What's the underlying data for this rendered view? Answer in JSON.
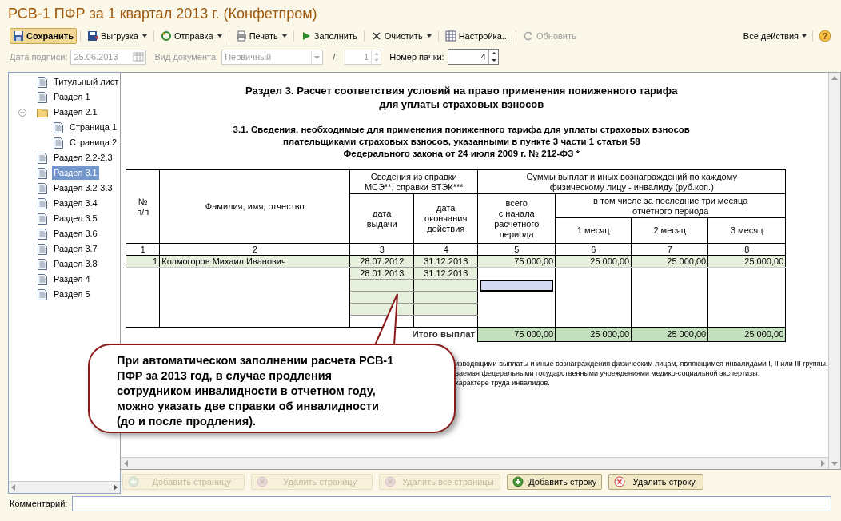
{
  "window": {
    "title": "РСВ-1 ПФР за 1 квартал 2013 г. (Конфетпром)"
  },
  "toolbar": [
    {
      "label": "Сохранить",
      "primary": true,
      "dropdown": false,
      "disabled": false
    },
    {
      "label": "Выгрузка",
      "primary": false,
      "dropdown": true,
      "disabled": false
    },
    {
      "label": "Отправка",
      "primary": false,
      "dropdown": true,
      "disabled": false
    },
    {
      "label": "Печать",
      "primary": false,
      "dropdown": true,
      "disabled": false
    },
    {
      "label": "Заполнить",
      "primary": false,
      "dropdown": false,
      "disabled": false
    },
    {
      "label": "Очистить",
      "primary": false,
      "dropdown": true,
      "disabled": false
    },
    {
      "label": "Настройка...",
      "primary": false,
      "dropdown": false,
      "disabled": false
    },
    {
      "label": "Обновить",
      "primary": false,
      "dropdown": false,
      "disabled": true
    }
  ],
  "all_actions": {
    "label": "Все действия",
    "dropdown": true
  },
  "help": "?",
  "fields": {
    "sign_date": {
      "label": "Дата подписи:",
      "value": "25.06.2013",
      "disabled": true
    },
    "doc_type": {
      "label": "Вид документа:",
      "value": "Первичный",
      "disabled": true
    },
    "separator": "/",
    "correction": {
      "value": "1",
      "disabled": true
    },
    "pack_number": {
      "label": "Номер пачки:",
      "value": "4",
      "disabled": false
    }
  },
  "tree": [
    {
      "label": "Титульный лист",
      "selected": false
    },
    {
      "label": "Раздел 1",
      "selected": false
    },
    {
      "label": "Раздел 2.1",
      "selected": false,
      "expanded": true,
      "children": [
        {
          "label": "Страница 1",
          "selected": false
        },
        {
          "label": "Страница 2",
          "selected": false
        }
      ]
    },
    {
      "label": "Раздел 2.2-2.3",
      "selected": false
    },
    {
      "label": "Раздел 3.1",
      "selected": true
    },
    {
      "label": "Раздел 3.2-3.3",
      "selected": false
    },
    {
      "label": "Раздел 3.4",
      "selected": false
    },
    {
      "label": "Раздел 3.5",
      "selected": false
    },
    {
      "label": "Раздел 3.6",
      "selected": false
    },
    {
      "label": "Раздел 3.7",
      "selected": false
    },
    {
      "label": "Раздел 3.8",
      "selected": false
    },
    {
      "label": "Раздел 4",
      "selected": false
    },
    {
      "label": "Раздел 5",
      "selected": false
    }
  ],
  "document": {
    "heading": "Раздел 3. Расчет соответствия условий на право применения пониженного тарифа\nдля уплаты страховых взносов",
    "subheading": "3.1. Сведения, необходимые для применения пониженного тарифа для уплаты страховых взносов\nплательщиками страховых взносов, указанными в пункте 3 части 1 статьи 58\nФедерального закона от 24 июля 2009 г. № 212-ФЗ *",
    "table": {
      "columns": {
        "num": "№\nп/п",
        "name": "Фамилия, имя, отчество",
        "certificate_group": "Сведения из справки\nМСЭ**, справки ВТЭК***",
        "issue_date": "дата\nвыдачи",
        "end_date": "дата\nокончания\nдействия",
        "sums_group": "Суммы выплат и иных вознаграждений по каждому\nфизическому лицу - инвалиду (руб.коп.)",
        "total": "всего\nс начала\nрасчетного\nпериода",
        "last3_group": "в том числе за последние три месяца\nотчетного периода",
        "month_1": "1 месяц",
        "month_2": "2 месяц",
        "month_3": "3 месяц"
      },
      "column_numbers": [
        "1",
        "2",
        "3",
        "4",
        "5",
        "6",
        "7",
        "8"
      ],
      "rows": [
        {
          "num": "1",
          "name": "Колмогоров Михаил Иванович",
          "certificates": [
            {
              "issue_date": "28.07.2012",
              "end_date": "31.12.2013"
            },
            {
              "issue_date": "28.01.2013",
              "end_date": "31.12.2013"
            }
          ],
          "total": "75 000,00",
          "month_1": "25 000,00",
          "month_2": "25 000,00",
          "month_3": "25 000,00"
        }
      ],
      "blank_lines": [
        {
          "selected": true
        },
        {
          "selected": false
        },
        {
          "selected": false
        }
      ],
      "totals": {
        "label": "Итого выплат",
        "total": "75 000,00",
        "month_1": "25 000,00",
        "month_2": "25 000,00",
        "month_3": "25 000,00"
      }
    },
    "footnotes": [
      "изводящими выплаты и иные вознаграждения физическим лицам, являющимся инвалидами I, II или III группы.",
      "ваемая федеральными государственными учреждениями медико-социальной экспертизы.",
      "характере труда инвалидов."
    ]
  },
  "callout": "При автоматическом заполнении расчета РСВ-1\nПФР за 2013 год, в случае продления\nсотрудником инвалидности в отчетном году,\nможно указать две справки об инвалидности\n(до и после продления).",
  "page_buttons": [
    {
      "label": "Добавить страницу",
      "disabled": true
    },
    {
      "label": "Удалить страницу",
      "disabled": true
    },
    {
      "label": "Удалить все страницы",
      "disabled": true
    },
    {
      "label": "Добавить строку",
      "disabled": false
    },
    {
      "label": "Удалить строку",
      "disabled": false
    }
  ],
  "comment": {
    "label": "Комментарий:"
  }
}
